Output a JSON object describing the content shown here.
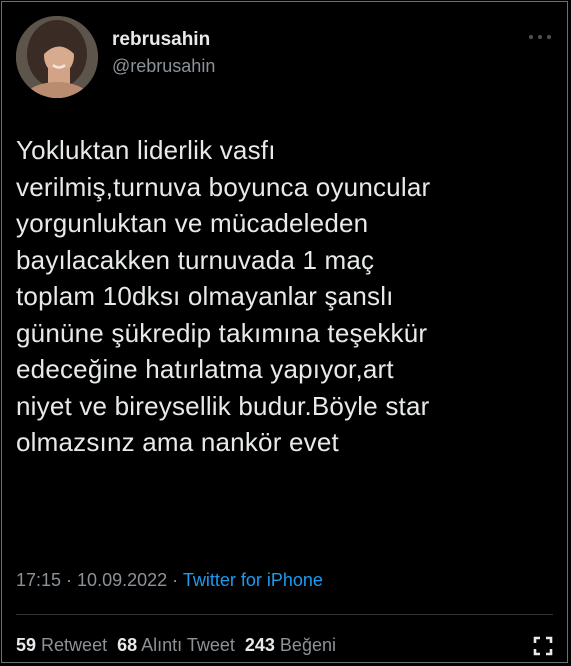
{
  "author": {
    "display_name": "rebrusahin",
    "handle": "@rebrusahin",
    "avatar_icon": "profile-photo"
  },
  "tweet": {
    "lines": [
      "Yokluktan liderlik vasfı",
      "verilmiş,turnuva boyunca oyuncular",
      "yorgunluktan ve mücadeleden",
      "bayılacakken  turnuvada 1 maç",
      "toplam 10dksı olmayanlar şanslı",
      "gününe şükredip takımına teşekkür",
      "edeceğine hatırlatma yapıyor,art",
      "niyet ve bireysellik budur.Böyle star",
      "olmazsınz ama nankör evet"
    ]
  },
  "meta": {
    "time": "17:15",
    "sep1": " · ",
    "date": "10.09.2022",
    "sep2": " · ",
    "source": "Twitter for iPhone"
  },
  "stats": {
    "retweets": "59",
    "retweets_label": "Retweet",
    "quotes": "68",
    "quotes_label": "Alıntı Tweet",
    "likes": "243",
    "likes_label": "Beğeni"
  },
  "colors": {
    "background": "#000000",
    "text": "#e7e9ea",
    "muted": "#8b9298",
    "link": "#1d9bf0"
  },
  "icons": {
    "more": "more-dots-icon",
    "expand": "expand-icon"
  }
}
